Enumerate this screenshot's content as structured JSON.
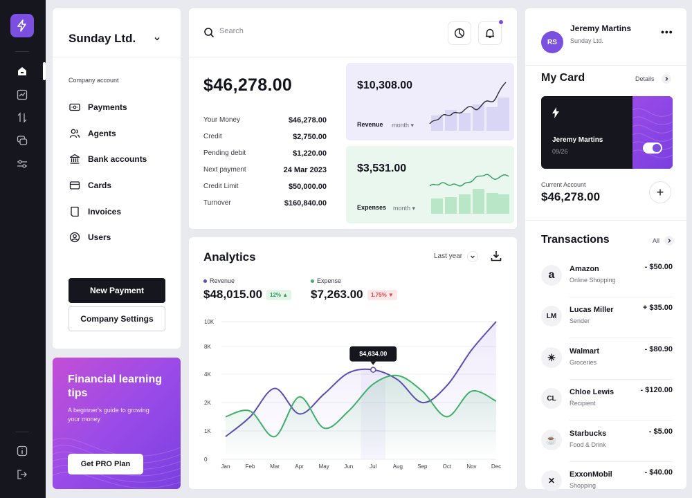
{
  "colors": {
    "accent": "#7b4fe0",
    "revenue": "#5b4bb4",
    "expenses": "#3fae6a",
    "dark": "#16161f",
    "negative": "#e0444b",
    "positive": "#3fae6a"
  },
  "company": {
    "name": "Sunday Ltd.",
    "account_label": "Company account",
    "menu": [
      {
        "label": "Payments",
        "icon": "payments-icon"
      },
      {
        "label": "Agents",
        "icon": "agents-icon"
      },
      {
        "label": "Bank accounts",
        "icon": "bank-icon"
      },
      {
        "label": "Cards",
        "icon": "card-icon"
      },
      {
        "label": "Invoices",
        "icon": "invoice-icon"
      },
      {
        "label": "Users",
        "icon": "user-icon"
      }
    ],
    "new_payment": "New Payment",
    "settings": "Company Settings"
  },
  "promo": {
    "title": "Financial learning tips",
    "subtitle": "A beginner's guide to growing your money",
    "button": "Get PRO Plan"
  },
  "search": {
    "placeholder": "Search"
  },
  "summary": {
    "total": "$46,278.00",
    "rows": [
      {
        "k": "Your Money",
        "v": "$46,278.00"
      },
      {
        "k": "Credit",
        "v": "$2,750.00"
      },
      {
        "k": "Pending debit",
        "v": "$1,220.00"
      },
      {
        "k": "Next payment",
        "v": "24 Mar 2023"
      },
      {
        "k": "Credit Limit",
        "v": "$50,000.00"
      },
      {
        "k": "Turnover",
        "v": "$160,840.00"
      }
    ],
    "revenue": {
      "amount": "$10,308.00",
      "label": "Revenue",
      "period": "month"
    },
    "expenses": {
      "amount": "$3,531.00",
      "label": "Expenses",
      "period": "month"
    }
  },
  "analytics": {
    "title": "Analytics",
    "range": "Last year",
    "revenue_label": "Revenue",
    "revenue_value": "$48,015.00",
    "revenue_badge": "12% ▲",
    "expense_label": "Expense",
    "expense_value": "$7,263.00",
    "expense_badge": "1.75% ▼",
    "tooltip": "$4,634.00"
  },
  "chart_data": {
    "type": "line",
    "x": [
      "Jan",
      "Feb",
      "Mar",
      "Apr",
      "May",
      "Jun",
      "Jul",
      "Aug",
      "Sep",
      "Oct",
      "Nov",
      "Dec"
    ],
    "y_ticks": [
      "0",
      "1K",
      "2K",
      "4K",
      "8K",
      "10K"
    ],
    "ylim": [
      0,
      10000
    ],
    "series": [
      {
        "name": "Revenue",
        "values": [
          800,
          1500,
          3000,
          1600,
          2600,
          4200,
          4634,
          3600,
          2000,
          3200,
          7500,
          10000
        ]
      },
      {
        "name": "Expense",
        "values": [
          1500,
          1700,
          800,
          2400,
          1100,
          1700,
          3300,
          3900,
          2800,
          1500,
          2800,
          2100
        ]
      }
    ],
    "highlight": {
      "x": "Jul",
      "value": 4634
    }
  },
  "user": {
    "initials": "RS",
    "name": "Jeremy Martins",
    "company": "Sunday Ltd."
  },
  "my_card": {
    "title": "My Card",
    "link": "Details",
    "holder": "Jeremy Martins",
    "expiry": "09/26",
    "account_label": "Current Account",
    "account_value": "$46,278.00"
  },
  "transactions": {
    "title": "Transactions",
    "link": "All",
    "items": [
      {
        "icon": "a",
        "name": "Amazon",
        "category": "Online Shopping",
        "amount": "- $50.00"
      },
      {
        "icon": "LM",
        "name": "Lucas Miller",
        "category": "Sender",
        "amount": "+ $35.00"
      },
      {
        "icon": "✳",
        "name": "Walmart",
        "category": "Groceries",
        "amount": "- $80.90"
      },
      {
        "icon": "CL",
        "name": "Chloe Lewis",
        "category": "Recipient",
        "amount": "- $120.00"
      },
      {
        "icon": "☕",
        "name": "Starbucks",
        "category": "Food & Drink",
        "amount": "- $5.00"
      },
      {
        "icon": "✕",
        "name": "ExxonMobil",
        "category": "Shopping",
        "amount": "- $40.00"
      }
    ]
  }
}
